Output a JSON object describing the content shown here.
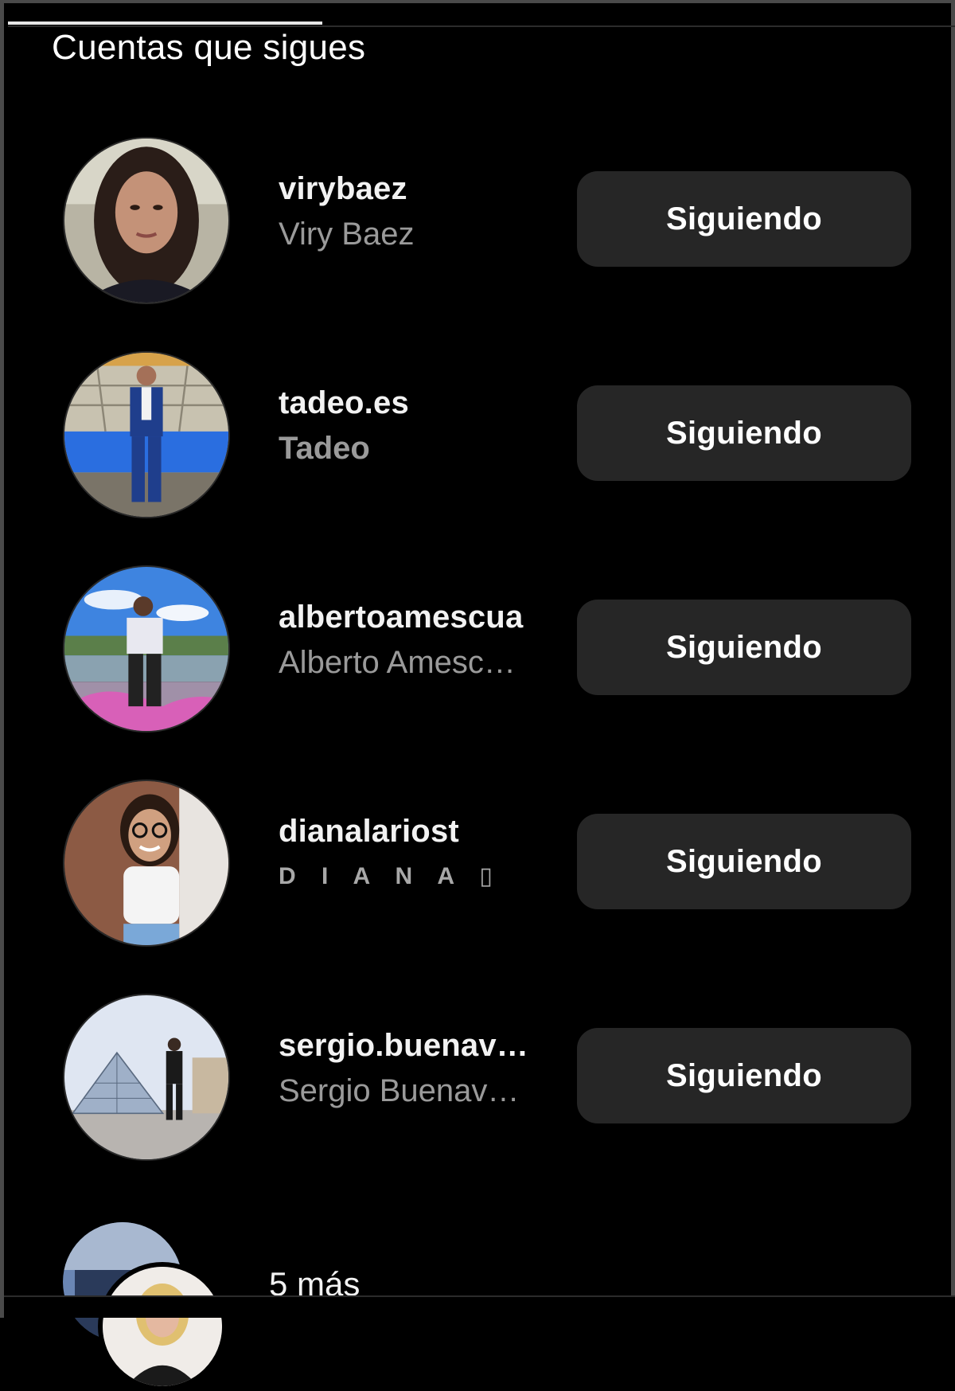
{
  "header": {
    "title": "Cuentas que sigues"
  },
  "accounts": [
    {
      "username": "virybaez",
      "full_name": "Viry Baez",
      "button_label": "Siguiendo"
    },
    {
      "username": "tadeo.es",
      "full_name": "Tadeo",
      "button_label": "Siguiendo"
    },
    {
      "username": "albertoamescua",
      "full_name": "Alberto Amesc…",
      "button_label": "Siguiendo"
    },
    {
      "username": "dianalariost",
      "full_name": "D I A N A ▯",
      "button_label": "Siguiendo"
    },
    {
      "username": "sergio.buenav…",
      "full_name": "Sergio Buenav…",
      "button_label": "Siguiendo"
    }
  ],
  "more": {
    "label": "5 más"
  },
  "colors": {
    "background": "#000000",
    "button": "#262626",
    "secondary_text": "#9a9a9a",
    "primary_text": "#ffffff"
  }
}
